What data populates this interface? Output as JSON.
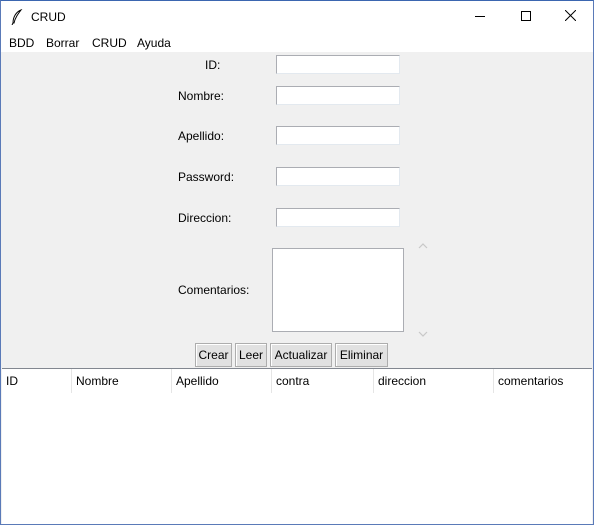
{
  "window": {
    "title": "CRUD",
    "icon": "feather-icon"
  },
  "menubar": {
    "items": [
      "BDD",
      "Borrar",
      "CRUD",
      "Ayuda"
    ]
  },
  "form": {
    "fields": [
      {
        "label": "ID:",
        "value": ""
      },
      {
        "label": "Nombre:",
        "value": ""
      },
      {
        "label": "Apellido:",
        "value": ""
      },
      {
        "label": "Password:",
        "value": ""
      },
      {
        "label": "Direccion:",
        "value": ""
      }
    ],
    "comments": {
      "label": "Comentarios:",
      "value": ""
    }
  },
  "buttons": {
    "crear": "Crear",
    "leer": "Leer",
    "actualizar": "Actualizar",
    "eliminar": "Eliminar"
  },
  "table": {
    "columns": [
      "ID",
      "Nombre",
      "Apellido",
      "contra",
      "direccion",
      "comentarios"
    ],
    "rows": []
  },
  "colors": {
    "window_border": "#3b66b0",
    "background": "#f0f0f0",
    "button": "#e1e1e1"
  }
}
